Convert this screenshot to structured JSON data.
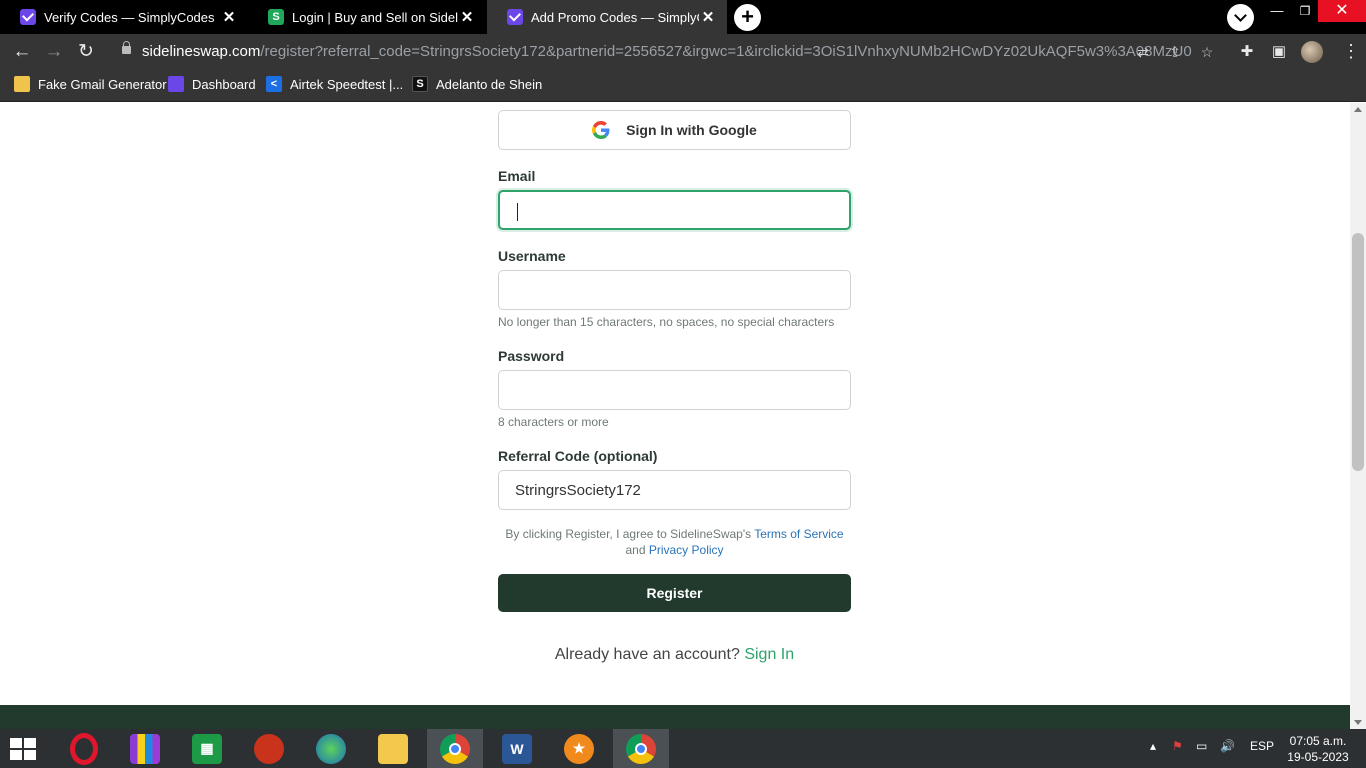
{
  "browser": {
    "tabs": [
      {
        "title": "Verify Codes — SimplyCodes",
        "favicon": "simplycodes-icon"
      },
      {
        "title": "Login | Buy and Sell on SidelineSwap",
        "favicon": "sidelineswap-icon"
      },
      {
        "title": "Add Promo Codes — SimplyCodes",
        "favicon": "simplycodes-icon"
      }
    ],
    "url_host": "sidelineswap.com",
    "url_rest": "/register?referral_code=StringrsSociety172&partnerid=2556527&irgwc=1&irclickid=3OiS1lVnhxyNUMb2HCwDYz02UkAQF5w3%3A08MzU0",
    "bookmarks": [
      {
        "label": "Fake Gmail Generator",
        "icon": "envelope-icon"
      },
      {
        "label": "Dashboard",
        "icon": "simplycodes-icon"
      },
      {
        "label": "Airtek Speedtest |...",
        "icon": "airtek-icon"
      },
      {
        "label": "Adelanto de Shein",
        "icon": "shein-icon"
      }
    ]
  },
  "form": {
    "google_button": "Sign In with Google",
    "email_label": "Email",
    "email_value": "",
    "username_label": "Username",
    "username_value": "",
    "username_hint": "No longer than 15 characters, no spaces, no special characters",
    "password_label": "Password",
    "password_value": "",
    "password_hint": "8 characters or more",
    "referral_label": "Referral Code (optional)",
    "referral_value": "StringrsSociety172",
    "terms_prefix": "By clicking Register, I agree to SidelineSwap's",
    "terms_link": "Terms of Service",
    "terms_and": "and",
    "privacy_link": "Privacy Policy",
    "register_button": "Register",
    "already_text": "Already have an account?",
    "sign_in_link": "Sign In"
  },
  "taskbar": {
    "language": "ESP",
    "time": "07:05 a.m.",
    "date": "19-05-2023"
  },
  "colors": {
    "accent_green": "#2ea36a",
    "register_bg": "#223a2d",
    "link_blue": "#2b74b8"
  }
}
